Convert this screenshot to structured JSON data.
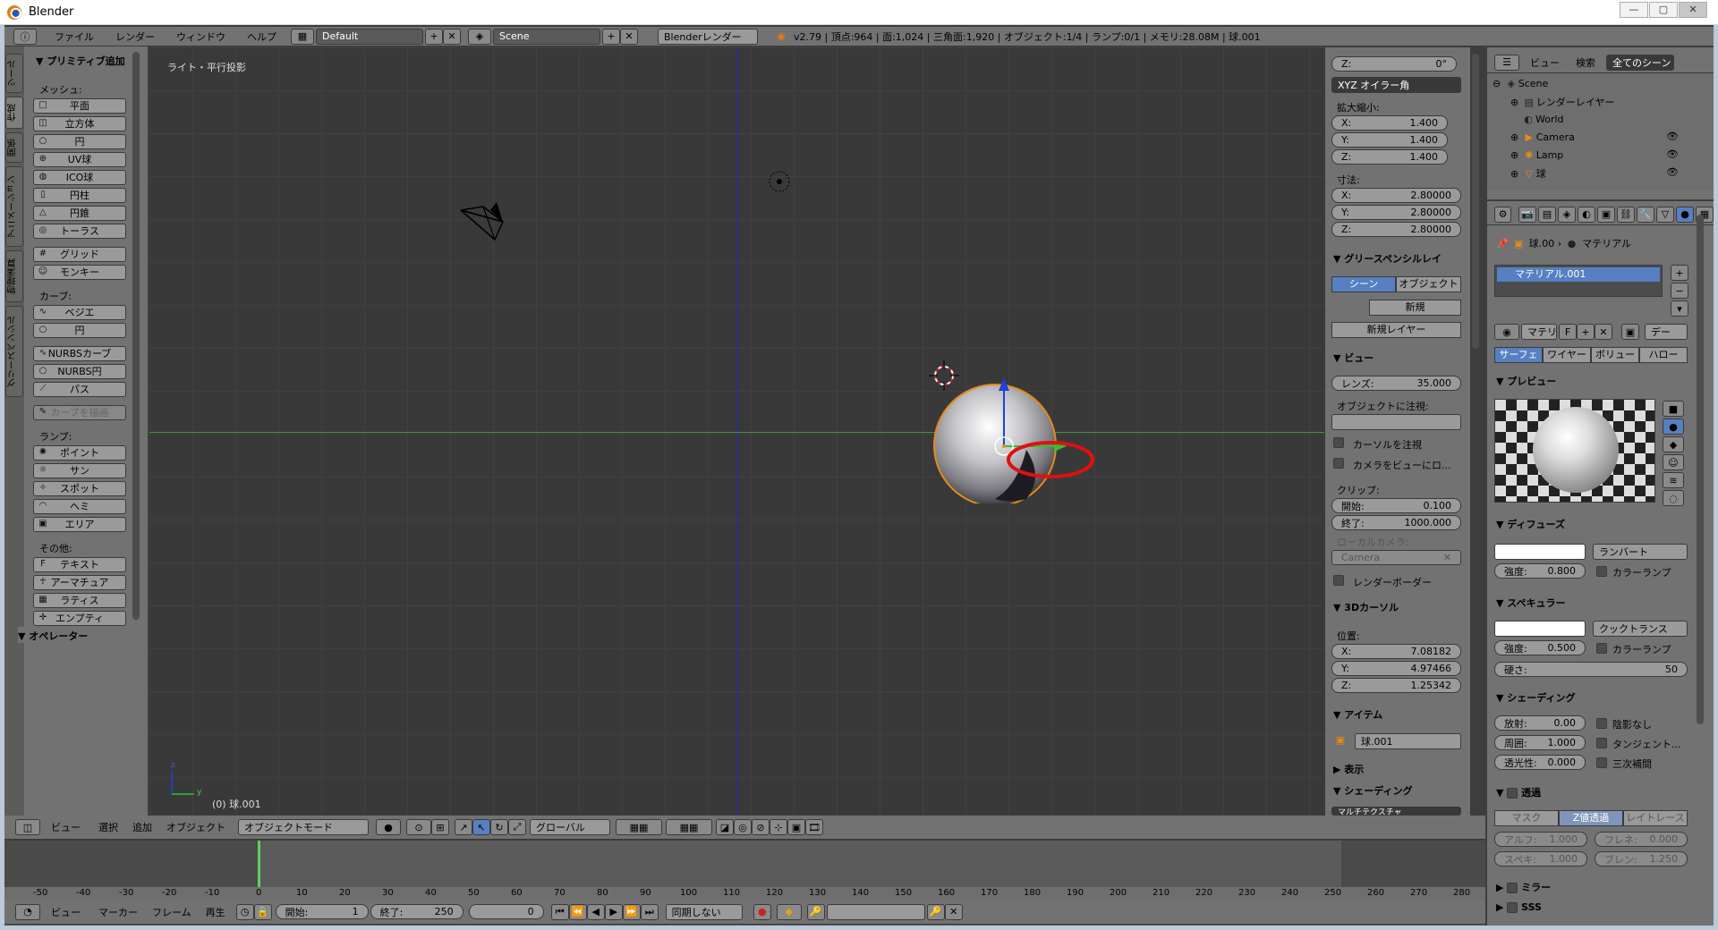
{
  "window": {
    "title": "Blender",
    "min_label": "—",
    "max_label": "▢",
    "close_label": "✕"
  },
  "info_bar": {
    "menus": [
      "ファイル",
      "レンダー",
      "ウィンドウ",
      "ヘルプ"
    ],
    "layout": "Default",
    "scene": "Scene",
    "engine": "Blenderレンダー",
    "stats": "v2.79 | 頂点:964 | 面:1,024 | 三角面:1,920 | オブジェクト:1/4 | ランプ:0/1 | メモリ:28.08M | 球.001"
  },
  "tool_shelf": {
    "tabs": [
      "ツール",
      "作成",
      "関係",
      "アニメーション",
      "物理演算",
      "グリースペンシル"
    ],
    "header": "プリミティブ追加",
    "mesh_label": "メッシュ:",
    "mesh": [
      "平面",
      "立方体",
      "円",
      "UV球",
      "ICO球",
      "円柱",
      "円錐",
      "トーラス"
    ],
    "mesh2": [
      "グリッド",
      "モンキー"
    ],
    "curve_label": "カーブ:",
    "curve": [
      "ベジエ",
      "円"
    ],
    "curve2": [
      "NURBSカーブ",
      "NURBS円",
      "パス"
    ],
    "draw_curve": "カーブを描画",
    "lamp_label": "ランプ:",
    "lamp": [
      "ポイント",
      "サン",
      "スポット",
      "ヘミ",
      "エリア"
    ],
    "other_label": "その他:",
    "other": [
      "テキスト",
      "アーマチュア",
      "ラティス",
      "エンプティ"
    ],
    "operator": "オペレーター"
  },
  "viewport": {
    "view_label": "ライト・平行投影",
    "object_label": "(0) 球.001",
    "axis_x": "y",
    "axis_z": "z"
  },
  "viewport_header": {
    "menus": [
      "ビュー",
      "選択",
      "追加",
      "オブジェクト"
    ],
    "mode": "オブジェクトモード",
    "orientation": "グローバル"
  },
  "npanel": {
    "rot_z": {
      "label": "Z:",
      "value": "0°"
    },
    "rot_mode": "XYZ オイラー角",
    "scale_label": "拡大縮小:",
    "scale": [
      {
        "label": "X:",
        "value": "1.400"
      },
      {
        "label": "Y:",
        "value": "1.400"
      },
      {
        "label": "Z:",
        "value": "1.400"
      }
    ],
    "dim_label": "寸法:",
    "dims": [
      {
        "label": "X:",
        "value": "2.80000"
      },
      {
        "label": "Y:",
        "value": "2.80000"
      },
      {
        "label": "Z:",
        "value": "2.80000"
      }
    ],
    "grease": "グリースペンシルレイ",
    "scene_tab": "シーン",
    "object_tab": "オブジェクト",
    "new": "新規",
    "new_layer": "新規レイヤー",
    "view": "ビュー",
    "lens": {
      "label": "レンズ:",
      "value": "35.000"
    },
    "lock_label": "オブジェクトに注視:",
    "lock_cursor": "カーソルを注視",
    "lock_camera": "カメラをビューにロ...",
    "clip_label": "クリップ:",
    "clip_start": {
      "label": "開始:",
      "value": "0.100"
    },
    "clip_end": {
      "label": "終了:",
      "value": "1000.000"
    },
    "local_camera": "ローカルカメラ:",
    "camera": "Camera",
    "render_border": "レンダーボーダー",
    "cursor": "3Dカーソル",
    "loc_label": "位置:",
    "cursor_loc": [
      {
        "label": "X:",
        "value": "7.08182"
      },
      {
        "label": "Y:",
        "value": "4.97466"
      },
      {
        "label": "Z:",
        "value": "1.25342"
      }
    ],
    "item": "アイテム",
    "item_name": "球.001",
    "display": "表示",
    "shading": "シェーディング",
    "matcap": "マルチテクスチャ"
  },
  "outliner": {
    "menus": [
      "ビュー",
      "検索"
    ],
    "filter": "全てのシーン",
    "items": [
      "Scene",
      "レンダーレイヤー",
      "World",
      "Camera",
      "Lamp",
      "球"
    ]
  },
  "properties": {
    "breadcrumb_obj": "球.00",
    "breadcrumb_mat": "マテリアル",
    "slot": "マテリアル.001",
    "mat_name": "マテリ",
    "mat_f": "F",
    "data": "デー",
    "type_tabs": [
      "サーフェ",
      "ワイヤー",
      "ボリュー",
      "ハロー"
    ],
    "preview": "プレビュー",
    "diffuse": "ディフューズ",
    "diffuse_shader": "ランバート",
    "diffuse_intensity": {
      "label": "強度:",
      "value": "0.800"
    },
    "ramp": "カラーランプ",
    "specular": "スペキュラー",
    "spec_shader": "クックトランス",
    "spec_intensity": {
      "label": "強度:",
      "value": "0.500"
    },
    "hardness": {
      "label": "硬さ:",
      "value": "50"
    },
    "shading": "シェーディング",
    "emit": {
      "label": "放射:",
      "value": "0.00"
    },
    "ambient": {
      "label": "周囲:",
      "value": "1.000"
    },
    "translucency": {
      "label": "透光性:",
      "value": "0.000"
    },
    "shadeless": "陰影なし",
    "tangent": "タンジェント...",
    "cubic": "三次補間",
    "transparency": "透過",
    "trans_tabs": [
      "マスク",
      "Z値透過",
      "レイトレース"
    ],
    "alpha": {
      "label": "アルフ:",
      "value": "1.000"
    },
    "fresnel": {
      "label": "フレネ:",
      "value": "0.000"
    },
    "specular_a": {
      "label": "スペキ:",
      "value": "1.000"
    },
    "blend": {
      "label": "ブレン:",
      "value": "1.250"
    },
    "mirror": "ミラー",
    "sss": "SSS"
  },
  "timeline": {
    "ticks": [
      "-50",
      "-40",
      "-30",
      "-20",
      "-10",
      "0",
      "10",
      "20",
      "30",
      "40",
      "50",
      "60",
      "70",
      "80",
      "90",
      "100",
      "110",
      "120",
      "130",
      "140",
      "150",
      "160",
      "170",
      "180",
      "190",
      "200",
      "210",
      "220",
      "230",
      "240",
      "250",
      "260",
      "270",
      "280"
    ],
    "menus": [
      "ビュー",
      "マーカー",
      "フレーム",
      "再生"
    ],
    "start": {
      "label": "開始:",
      "value": "1"
    },
    "end": {
      "label": "終了:",
      "value": "250"
    },
    "current": "0",
    "sync": "同期しない"
  }
}
